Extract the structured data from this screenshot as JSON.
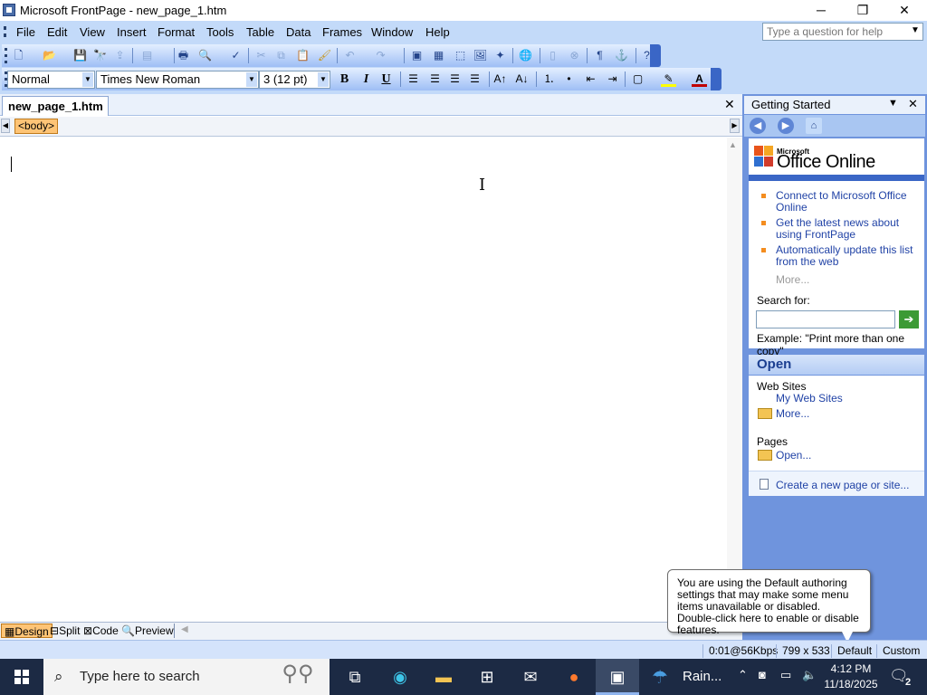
{
  "window": {
    "title": "Microsoft FrontPage - new_page_1.htm",
    "minimize": "─",
    "restore": "❐",
    "close": "✕"
  },
  "menu": [
    "File",
    "Edit",
    "View",
    "Insert",
    "Format",
    "Tools",
    "Table",
    "Data",
    "Frames",
    "Window",
    "Help"
  ],
  "help_box": {
    "placeholder": "Type a question for help"
  },
  "formatting": {
    "style": "Normal",
    "font": "Times New Roman",
    "size": "3  (12 pt)",
    "bold": "B",
    "italic": "I",
    "underline": "U"
  },
  "document": {
    "tab": "new_page_1.htm",
    "tag": "<body>"
  },
  "view_modes": [
    "Design",
    "Split",
    "Code",
    "Preview"
  ],
  "task_pane": {
    "title": "Getting Started",
    "office_small": "Microsoft",
    "office_big": "Office Online",
    "links": [
      "Connect to Microsoft Office Online",
      "Get the latest news about using FrontPage",
      "Automatically update this list from the web"
    ],
    "more": "More...",
    "search_label": "Search for:",
    "example": "Example:  \"Print more than one copy\"",
    "open_header": "Open",
    "web_sites_label": "Web Sites",
    "my_web_sites": "My Web Sites",
    "web_more": "More...",
    "pages_label": "Pages",
    "pages_open": "Open...",
    "create": "Create a new page or site..."
  },
  "tooltip": "You are using the Default authoring settings that may make some menu items unavailable or disabled.  Double-click here to enable or disable features.",
  "status": {
    "speed": "0:01@56Kbps",
    "size": "799 x 533",
    "authoring": "Default",
    "custom": "Custom"
  },
  "taskbar": {
    "search_placeholder": "Type here to search",
    "weather": "Rain...",
    "time": "4:12 PM",
    "date": "11/18/2025",
    "notifications": "2"
  },
  "colors": {
    "chrome": "#c3daf9",
    "accent": "#3a66c6",
    "tag_highlight": "#fec476",
    "link": "#2143a6",
    "taskbar": "#1c2a44"
  }
}
